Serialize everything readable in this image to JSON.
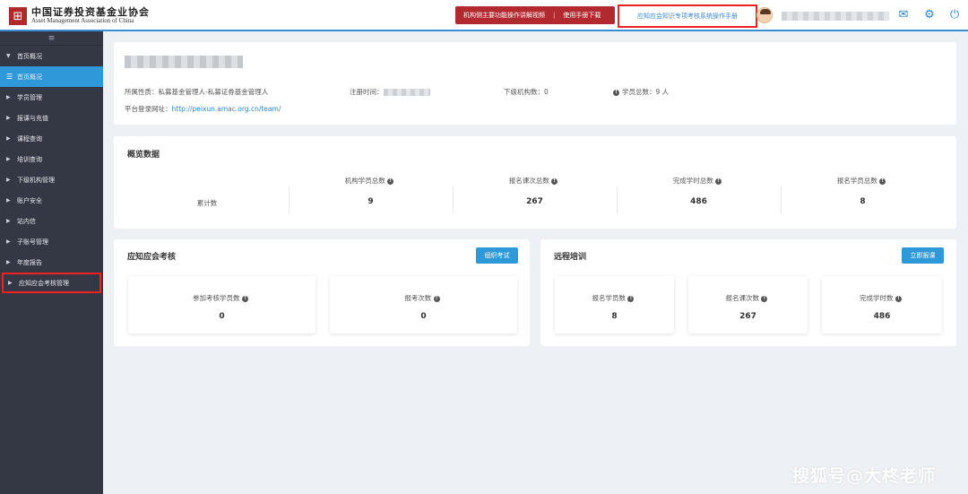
{
  "header": {
    "logo_cn": "中国证券投资基金业协会",
    "logo_en": "Asset Management Association of China",
    "video_link": "机构侧主要功能操作讲解视频",
    "separator": "|",
    "manual_download": "使用手册下载",
    "exam_manual": "应知应会知识专项考核系统操作手册"
  },
  "sidebar": {
    "toggle": "≡",
    "items": [
      {
        "label": "首页概况",
        "caret": "▼"
      },
      {
        "label": "首页概况",
        "caret": "☰"
      },
      {
        "label": "学员管理",
        "caret": "▶"
      },
      {
        "label": "报课与充值",
        "caret": "▶"
      },
      {
        "label": "课程查询",
        "caret": "▶"
      },
      {
        "label": "培训查询",
        "caret": "▶"
      },
      {
        "label": "下级机构管理",
        "caret": "▶"
      },
      {
        "label": "账户安全",
        "caret": "▶"
      },
      {
        "label": "站内信",
        "caret": "▶"
      },
      {
        "label": "子账号管理",
        "caret": "▶"
      },
      {
        "label": "年度报告",
        "caret": "▶"
      },
      {
        "label": "应知应会考核管理",
        "caret": "▶"
      }
    ]
  },
  "profile": {
    "nature": "所属性质：私募基金管理人-私募证券基金管理人",
    "reg_time_label": "注册时间：",
    "sub_orgs": "下级机构数：0",
    "students": "学员总数：9 人",
    "url_label": "平台登录网址：",
    "url": "http://peixun.amac.org.cn/team/"
  },
  "overview": {
    "title": "概览数据",
    "row_label": "累计数",
    "columns": [
      {
        "label": "机构学员总数",
        "value": "9"
      },
      {
        "label": "报名课次总数",
        "value": "267"
      },
      {
        "label": "完成学时总数",
        "value": "486"
      },
      {
        "label": "报名学员总数",
        "value": "8"
      }
    ]
  },
  "exam": {
    "title": "应知应会考核",
    "button": "组织考试",
    "stats": [
      {
        "label": "参加考核学员数",
        "value": "0"
      },
      {
        "label": "报考次数",
        "value": "0"
      }
    ]
  },
  "remote": {
    "title": "远程培训",
    "button": "立即报课",
    "stats": [
      {
        "label": "报名学员数",
        "value": "8"
      },
      {
        "label": "报名课次数",
        "value": "267"
      },
      {
        "label": "完成学时数",
        "value": "486"
      }
    ]
  },
  "watermark": "搜狐号@大柊老师",
  "icons": {
    "mail": "mail-icon",
    "settings": "gear-icon",
    "power": "power-icon",
    "info": "info-icon"
  },
  "colors": {
    "accent": "#2e98d8",
    "sidebar": "#333844",
    "brand_red": "#b22a2f"
  }
}
